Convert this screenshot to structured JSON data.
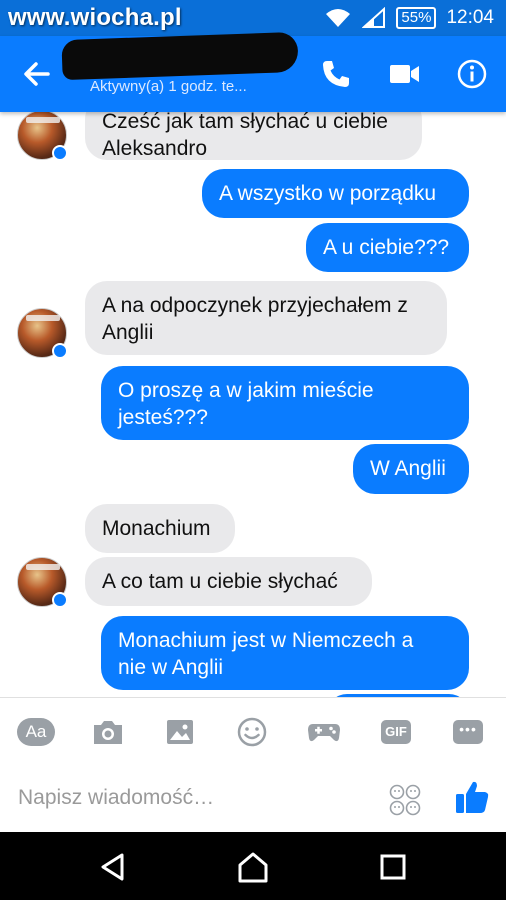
{
  "status_bar": {
    "watermark": "www.wiocha.pl",
    "battery": "55%",
    "time": "12:04"
  },
  "header": {
    "contact_status": "Aktywny(a) 1 godz. te...",
    "icons": [
      "back-arrow-icon",
      "phone-icon",
      "video-icon",
      "info-icon"
    ]
  },
  "messages": [
    {
      "side": "in",
      "text": "Cześć jak tam słychać u ciebie\nAleksandro"
    },
    {
      "side": "out",
      "text": "A wszystko w porządku"
    },
    {
      "side": "out",
      "text": "A u ciebie???"
    },
    {
      "side": "in",
      "text": "A na odpoczynek przyjechałem z\nAnglii"
    },
    {
      "side": "out",
      "text": "O proszę a w jakim mieście\njesteś???"
    },
    {
      "side": "out",
      "text": "W Anglii"
    },
    {
      "side": "in",
      "text": "Monachium"
    },
    {
      "side": "in",
      "text": "A co tam u ciebie słychać"
    },
    {
      "side": "out",
      "text": "Monachium jest w Niemczech a\nnie w Anglii"
    }
  ],
  "composer": {
    "aa_label": "Aa",
    "gif_label": "GIF",
    "more_label": "•••",
    "placeholder": "Napisz wiadomość…",
    "tools": [
      "aa-icon",
      "camera-icon",
      "image-icon",
      "smiley-icon",
      "gamepad-icon",
      "gif-icon",
      "more-icon"
    ]
  },
  "colors": {
    "header": "#0a7cff",
    "status_bar": "#0a6fd8",
    "outgoing_bubble": "#0a7cff",
    "incoming_bubble": "#e9e9eb",
    "icon_gray": "#9aa0a6"
  }
}
